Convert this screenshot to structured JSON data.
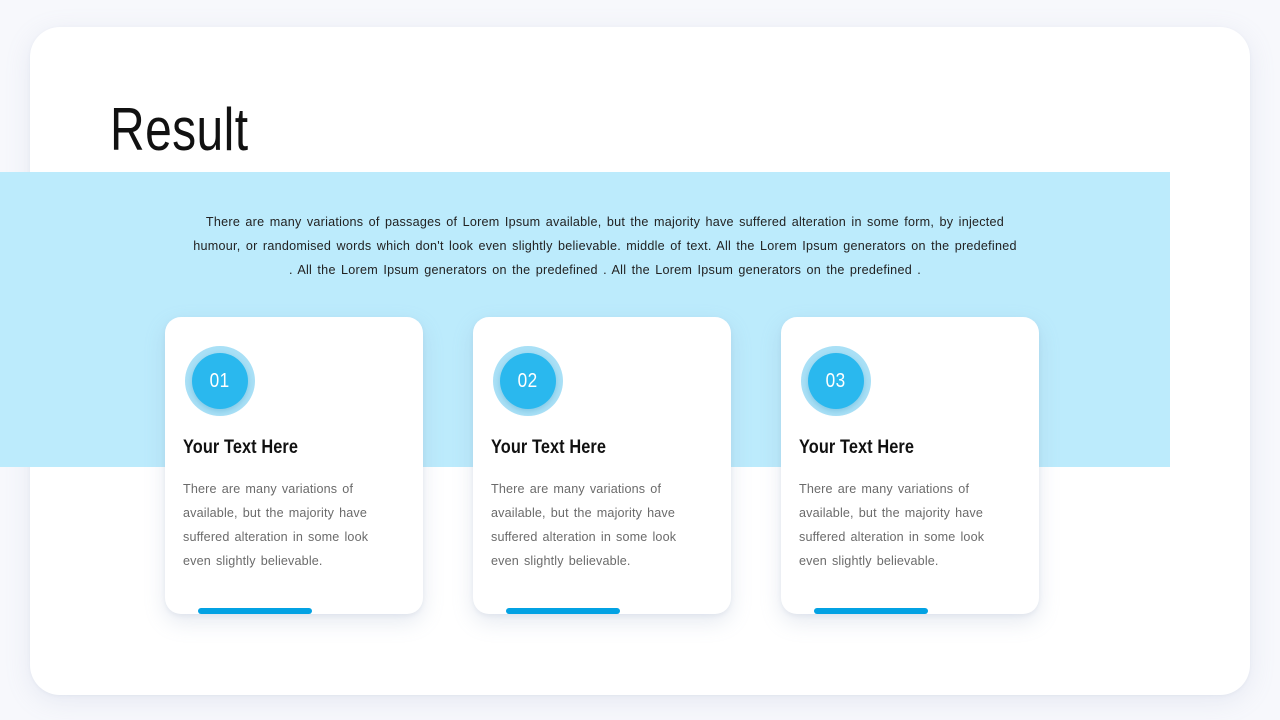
{
  "page": {
    "background_color": "#f7f8fc",
    "panel_color": "#ffffff"
  },
  "band": {
    "color": "#bcebfc"
  },
  "header": {
    "title": "Result"
  },
  "intro": {
    "text": "There are many variations of passages  of Lorem Ipsum available,  but the majority have suffered  alteration in some form, by injected humour, or randomised  words which don't look even slightly believable.  middle  of text. All the Lorem Ipsum generators  on the predefined  . All the Lorem Ipsum generators  on the predefined  . All the Lorem Ipsum generators  on the predefined  ."
  },
  "accent_colors": {
    "badge_ring": "#a9e0f6",
    "badge_fill": "#2ab8ee",
    "bar": "#03a2e3"
  },
  "cards": [
    {
      "number": "01",
      "title": "Your Text Here",
      "body": "There are many variations of available,  but the majority have suffered  alteration in some look even slightly believable."
    },
    {
      "number": "02",
      "title": "Your Text Here",
      "body": "There are many variations of available,  but the majority have suffered  alteration in some look even slightly believable."
    },
    {
      "number": "03",
      "title": "Your Text Here",
      "body": "There are many variations of available,  but the majority have suffered  alteration in some look even slightly believable."
    }
  ]
}
